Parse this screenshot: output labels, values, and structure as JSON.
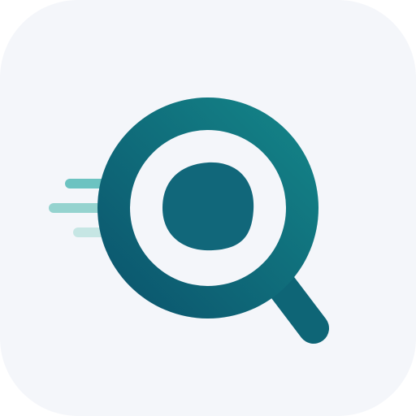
{
  "icon": {
    "name": "search-app-icon",
    "glyph": "magnifying-glass-with-motion-lines",
    "colors": {
      "tile_background": "#F4F6FA",
      "ring_start": "#137F85",
      "ring_end": "#0C5A70",
      "lens_core": "#11677A",
      "handle": "#0E6576",
      "speed_line_top": "#6CC3C1",
      "speed_line_middle": "#95D3CF",
      "speed_line_bottom": "#C6E6E4"
    }
  }
}
